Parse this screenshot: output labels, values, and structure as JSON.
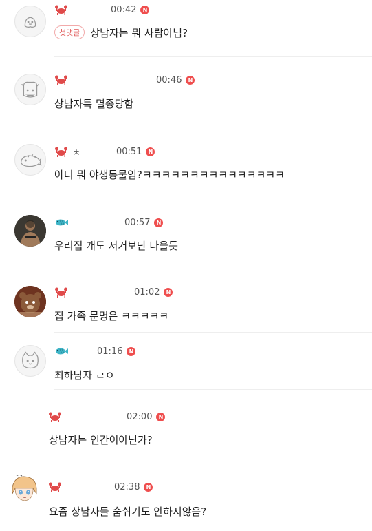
{
  "comments": [
    {
      "badge": "crab",
      "time": "00:42",
      "first_tag": "첫댓글",
      "text": "상남자는 뭐 사람아님?",
      "avatar": "default"
    },
    {
      "badge": "crab",
      "time": "00:46",
      "text": "상남자특 멸종당함",
      "avatar": "default"
    },
    {
      "badge": "crab",
      "name_fragment": "ㅊ",
      "time": "00:51",
      "text": "아니 뭐 야생동물임?ㅋㅋㅋㅋㅋㅋㅋㅋㅋㅋㅋㅋㅋㅋㅋ",
      "avatar": "default"
    },
    {
      "badge": "fish",
      "time": "00:57",
      "text": "우리집 개도 저거보단 나을듯",
      "avatar": "photo-man"
    },
    {
      "badge": "crab",
      "time": "01:02",
      "text": "집 가족 문명은 ㅋㅋㅋㅋㅋ",
      "avatar": "photo-bear"
    },
    {
      "badge": "fish",
      "time": "01:16",
      "text": "최하남자 ㄹㅇ",
      "avatar": "default"
    },
    {
      "badge": "crab",
      "time": "02:00",
      "text": "상남자는 인간이아닌가?",
      "avatar": "hidden"
    },
    {
      "badge": "crab",
      "time": "02:38",
      "text": "요즘 상남자들 숨쉬기도 안하지않음?",
      "avatar": "anime"
    }
  ],
  "colors": {
    "new_badge": "#ef4e4e",
    "first_tag": "#e05a5a",
    "divider": "#eeeeee"
  },
  "new_badge_label": "N"
}
